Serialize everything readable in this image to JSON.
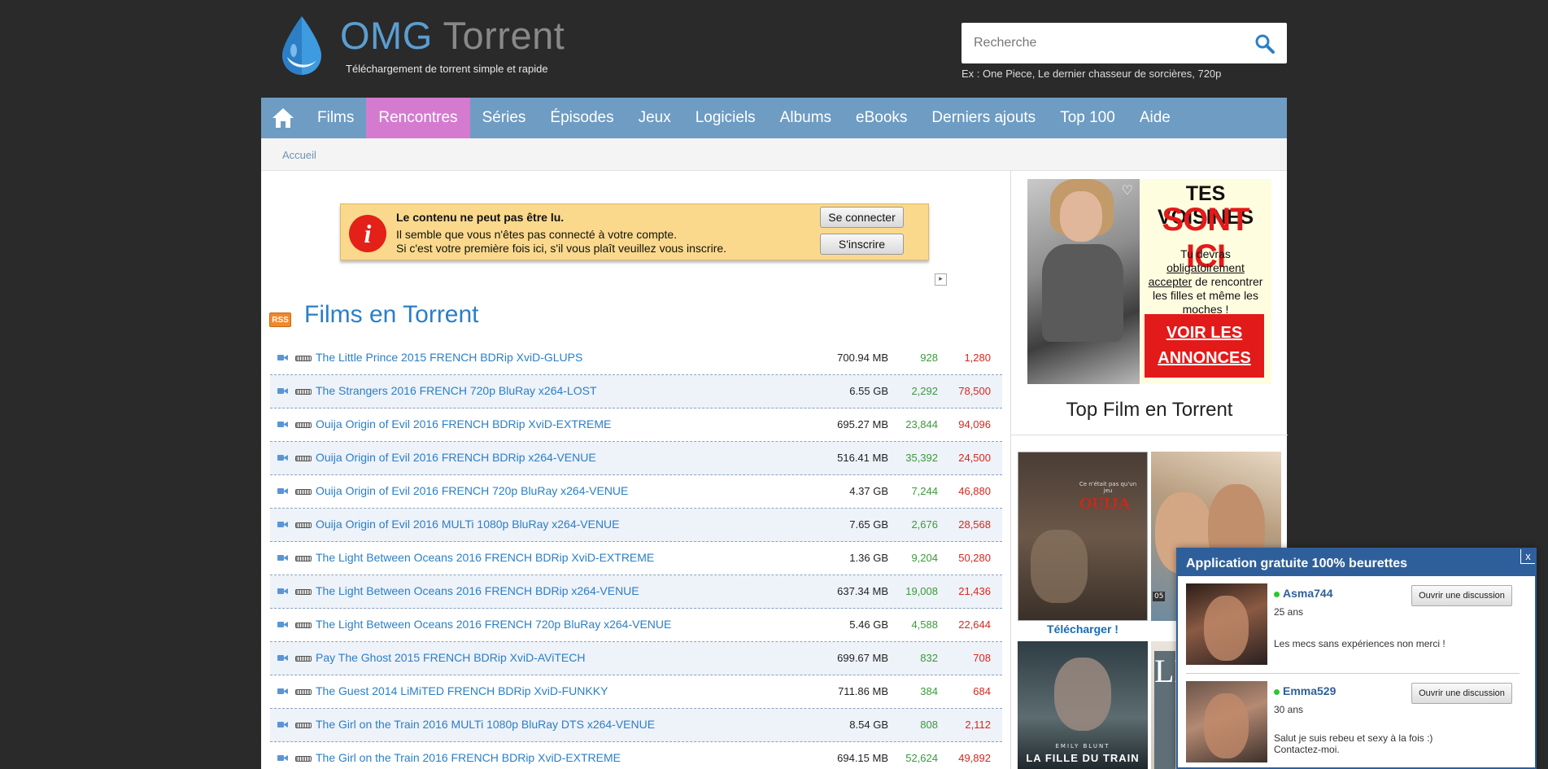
{
  "header": {
    "brand_omg": "OMG",
    "brand_torrent": "Torrent",
    "tagline": "Téléchargement de torrent simple et rapide",
    "search_placeholder": "Recherche",
    "search_hint": "Ex : One Piece, Le dernier chasseur de sorcières, 720p"
  },
  "nav": {
    "items": [
      {
        "label": "Films",
        "active": false
      },
      {
        "label": "Rencontres",
        "active": true
      },
      {
        "label": "Séries",
        "active": false
      },
      {
        "label": "Épisodes",
        "active": false
      },
      {
        "label": "Jeux",
        "active": false
      },
      {
        "label": "Logiciels",
        "active": false
      },
      {
        "label": "Albums",
        "active": false
      },
      {
        "label": "eBooks",
        "active": false
      },
      {
        "label": "Derniers ajouts",
        "active": false
      },
      {
        "label": "Top 100",
        "active": false
      },
      {
        "label": "Aide",
        "active": false
      }
    ],
    "active_color": "#d47bd0",
    "bar_color": "#6e9cc3"
  },
  "breadcrumb": {
    "home": "Accueil"
  },
  "notice": {
    "title": "Le contenu ne peut pas être lu.",
    "line1": "Il semble que vous n'êtes pas connecté à votre compte.",
    "line2": "Si c'est votre première fois ici, s'il vous plaît veuillez vous inscrire.",
    "login_button": "Se connecter",
    "signup_button": "S'inscrire"
  },
  "section": {
    "rss_label": "RSS",
    "title": "Films en Torrent"
  },
  "torrents": [
    {
      "name": "The Little Prince 2015 FRENCH BDRip XviD-GLUPS",
      "size": "700.94 MB",
      "seeders": "928",
      "leechers": "1,280"
    },
    {
      "name": "The Strangers 2016 FRENCH 720p BluRay x264-LOST",
      "size": "6.55 GB",
      "seeders": "2,292",
      "leechers": "78,500"
    },
    {
      "name": "Ouija Origin of Evil 2016 FRENCH BDRip XviD-EXTREME",
      "size": "695.27 MB",
      "seeders": "23,844",
      "leechers": "94,096"
    },
    {
      "name": "Ouija Origin of Evil 2016 FRENCH BDRip x264-VENUE",
      "size": "516.41 MB",
      "seeders": "35,392",
      "leechers": "24,500"
    },
    {
      "name": "Ouija Origin of Evil 2016 FRENCH 720p BluRay x264-VENUE",
      "size": "4.37 GB",
      "seeders": "7,244",
      "leechers": "46,880"
    },
    {
      "name": "Ouija Origin of Evil 2016 MULTi 1080p BluRay x264-VENUE",
      "size": "7.65 GB",
      "seeders": "2,676",
      "leechers": "28,568"
    },
    {
      "name": "The Light Between Oceans 2016 FRENCH BDRip XviD-EXTREME",
      "size": "1.36 GB",
      "seeders": "9,204",
      "leechers": "50,280"
    },
    {
      "name": "The Light Between Oceans 2016 FRENCH BDRip x264-VENUE",
      "size": "637.34 MB",
      "seeders": "19,008",
      "leechers": "21,436"
    },
    {
      "name": "The Light Between Oceans 2016 FRENCH 720p BluRay x264-VENUE",
      "size": "5.46 GB",
      "seeders": "4,588",
      "leechers": "22,644"
    },
    {
      "name": "Pay The Ghost 2015 FRENCH BDRip XviD-AViTECH",
      "size": "699.67 MB",
      "seeders": "832",
      "leechers": "708"
    },
    {
      "name": "The Guest 2014 LiMiTED FRENCH BDRip XviD-FUNKKY",
      "size": "711.86 MB",
      "seeders": "384",
      "leechers": "684"
    },
    {
      "name": "The Girl on the Train 2016 MULTi 1080p BluRay DTS x264-VENUE",
      "size": "8.54 GB",
      "seeders": "808",
      "leechers": "2,112"
    },
    {
      "name": "The Girl on the Train 2016 FRENCH BDRip XviD-EXTREME",
      "size": "694.15 MB",
      "seeders": "52,624",
      "leechers": "49,892"
    }
  ],
  "side_ad": {
    "line1": "TES VOISINES",
    "line2": "SONT ICI",
    "text_a": "Tu devras ",
    "text_u1": "obligatoirement",
    "text_u2": "accepter",
    "text_b": " de rencontrer les filles et même les moches !",
    "cta1": "VOIR LES",
    "cta2": "ANNONCES"
  },
  "sidebar": {
    "title": "Top Film en Torrent",
    "poster1_tagline": "Ce n'était pas qu'un jeu",
    "poster1_title": "OUIJA",
    "poster2_tag": "05",
    "download_label": "Télécharger !",
    "poster3_credit": "EMILY BLUNT",
    "poster3_title": "LA FILLE DU TRAIN",
    "poster4_title": "LE"
  },
  "chat": {
    "header": "Application gratuite 100% beurettes",
    "close": "x",
    "users": [
      {
        "name": "Asma744",
        "age": "25 ans",
        "message": "Les mecs sans expériences non merci !",
        "button": "Ouvrir une discussion"
      },
      {
        "name": "Emma529",
        "age": "30 ans",
        "message": "Salut je suis rebeu et sexy à la fois :) Contactez-moi.",
        "button": "Ouvrir une discussion"
      }
    ]
  }
}
